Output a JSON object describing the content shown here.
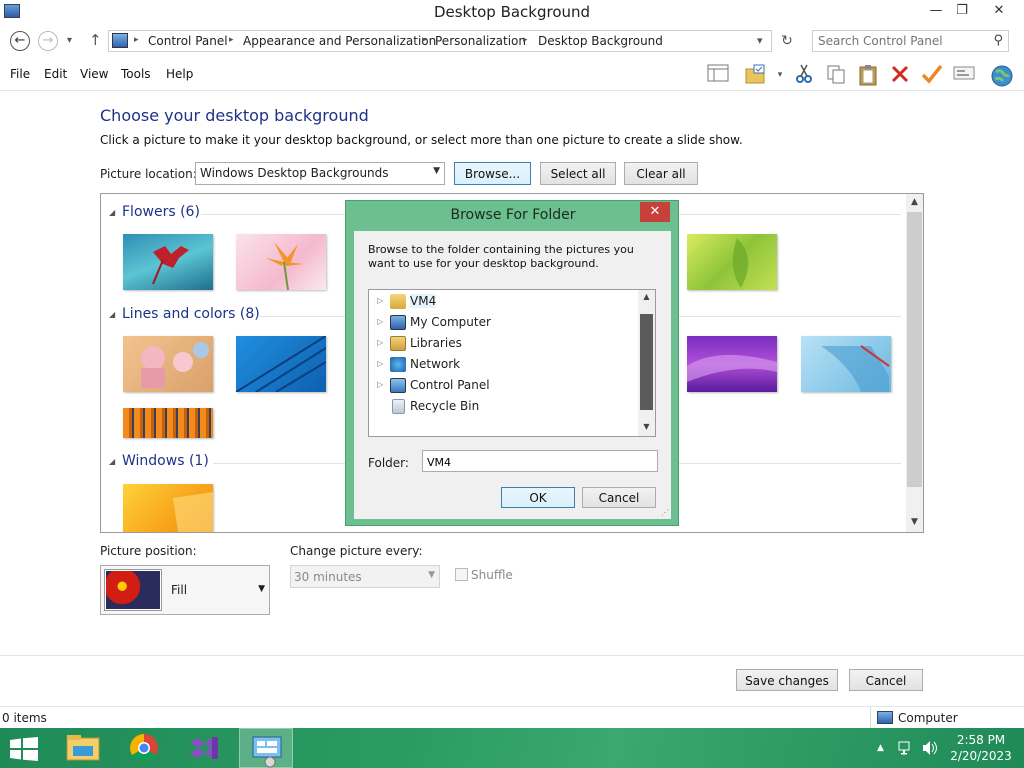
{
  "window": {
    "title": "Desktop Background",
    "minimize": "—",
    "maximize": "❐",
    "close": "✕"
  },
  "address": {
    "back": "←",
    "forward": "→",
    "recent": "▾",
    "up": "↑",
    "breadcrumbs": [
      "Control Panel",
      "Appearance and Personalization",
      "Personalization",
      "Desktop Background"
    ],
    "separator": "▸",
    "dropdown": "▾",
    "refresh": "↻",
    "search_placeholder": "Search Control Panel",
    "search_icon": "⚲"
  },
  "menu": {
    "items": [
      "File",
      "Edit",
      "View",
      "Tools",
      "Help"
    ]
  },
  "toolbar_icons": [
    "layout-icon",
    "folder-options-icon",
    "cut-icon",
    "copy-icon",
    "paste-icon",
    "delete-icon",
    "check-icon",
    "properties-icon",
    "globe-icon"
  ],
  "main": {
    "heading": "Choose your desktop background",
    "subtext": "Click a picture to make it your desktop background, or select more than one picture to create a slide show.",
    "location_label": "Picture location:",
    "location_value": "Windows Desktop Backgrounds",
    "browse_button": "Browse...",
    "select_all_button": "Select all",
    "clear_all_button": "Clear all"
  },
  "gallery": {
    "groups": [
      {
        "label": "Flowers (6)"
      },
      {
        "label": "Lines and colors (8)"
      },
      {
        "label": "Windows (1)"
      }
    ]
  },
  "dialog": {
    "title": "Browse For Folder",
    "close": "✕",
    "description": "Browse to the folder containing the pictures you want to use for your desktop background.",
    "tree": [
      {
        "label": "VM4",
        "selected": true
      },
      {
        "label": "My Computer"
      },
      {
        "label": "Libraries"
      },
      {
        "label": "Network"
      },
      {
        "label": "Control Panel"
      },
      {
        "label": "Recycle Bin"
      }
    ],
    "folder_label": "Folder:",
    "folder_value": "VM4",
    "ok_button": "OK",
    "cancel_button": "Cancel"
  },
  "settings": {
    "position_label": "Picture position:",
    "position_value": "Fill",
    "interval_label": "Change picture every:",
    "interval_value": "30 minutes",
    "shuffle_label": "Shuffle"
  },
  "footer": {
    "save_button": "Save changes",
    "cancel_button": "Cancel"
  },
  "status": {
    "items": "0 items",
    "location": "Computer"
  },
  "taskbar": {
    "time": "2:58 PM",
    "date": "2/20/2023",
    "tray_expand": "▲"
  },
  "colors": {
    "heading": "#1e3287",
    "dialog_frame": "#6cbf8f",
    "taskbar": "#2a9c63",
    "close_button": "#c7413a"
  }
}
